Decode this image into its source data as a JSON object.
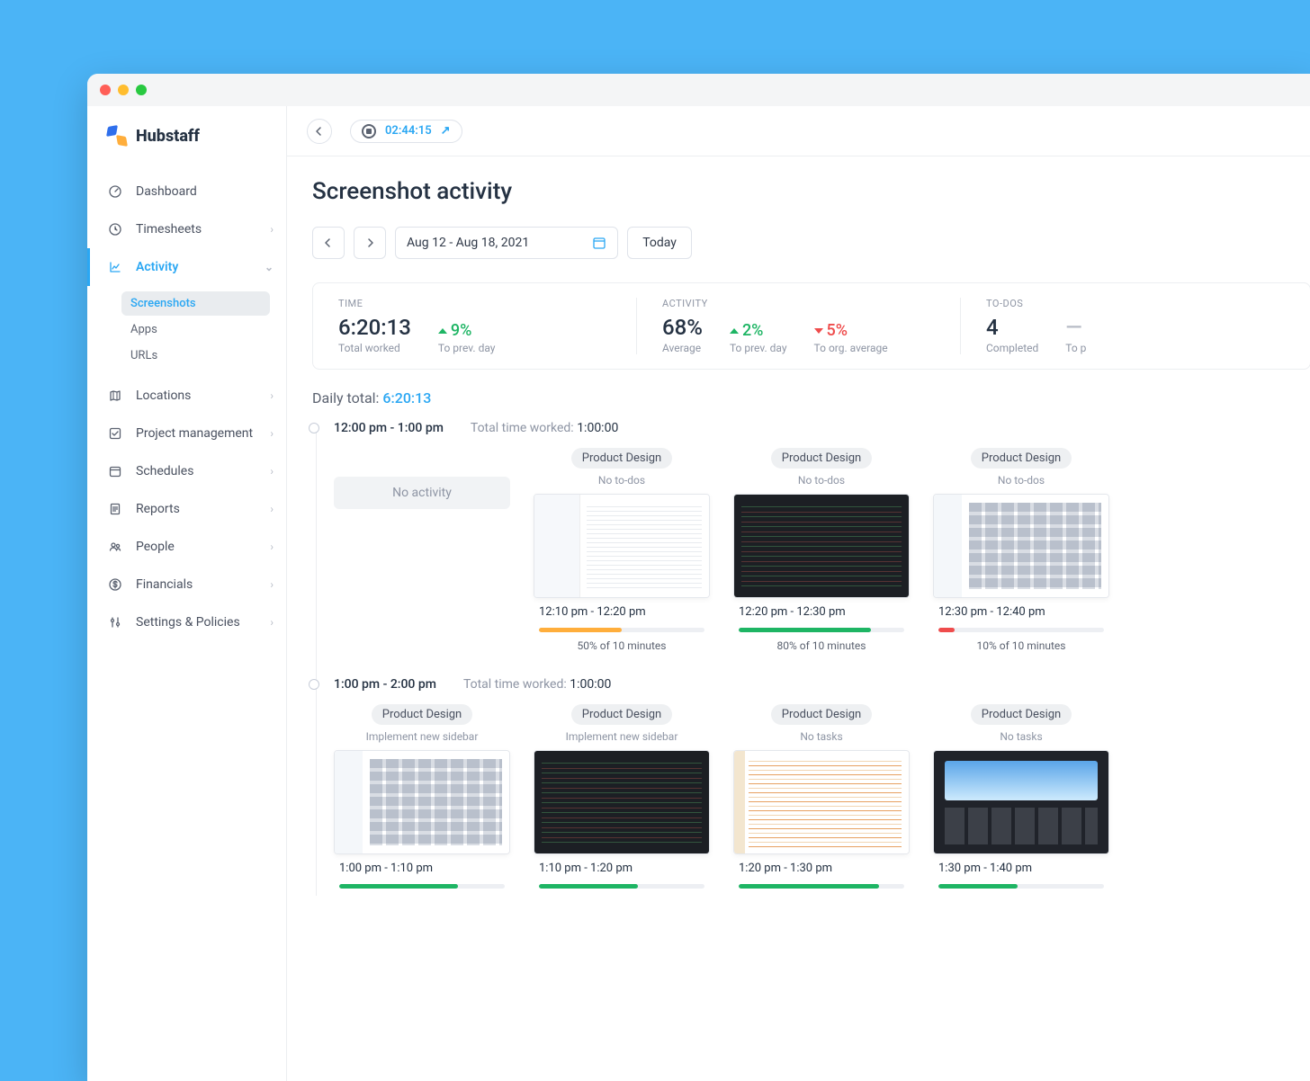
{
  "brand": {
    "name": "Hubstaff"
  },
  "topbar": {
    "timer": "02:44:15"
  },
  "sidebar": {
    "items": [
      {
        "id": "dashboard",
        "label": "Dashboard",
        "icon": "gauge-icon",
        "expandable": false
      },
      {
        "id": "timesheets",
        "label": "Timesheets",
        "icon": "clock-icon",
        "expandable": true
      },
      {
        "id": "activity",
        "label": "Activity",
        "icon": "chart-icon",
        "expandable": true,
        "active": true,
        "children": [
          {
            "id": "screenshots",
            "label": "Screenshots",
            "selected": true
          },
          {
            "id": "apps",
            "label": "Apps"
          },
          {
            "id": "urls",
            "label": "URLs"
          }
        ]
      },
      {
        "id": "locations",
        "label": "Locations",
        "icon": "map-icon",
        "expandable": true
      },
      {
        "id": "project",
        "label": "Project management",
        "icon": "check-icon",
        "expandable": true
      },
      {
        "id": "schedules",
        "label": "Schedules",
        "icon": "calendar-icon",
        "expandable": true
      },
      {
        "id": "reports",
        "label": "Reports",
        "icon": "doc-icon",
        "expandable": true
      },
      {
        "id": "people",
        "label": "People",
        "icon": "people-icon",
        "expandable": true
      },
      {
        "id": "financials",
        "label": "Financials",
        "icon": "dollar-icon",
        "expandable": true
      },
      {
        "id": "settings",
        "label": "Settings & Policies",
        "icon": "sliders-icon",
        "expandable": true
      }
    ]
  },
  "page": {
    "title": "Screenshot activity",
    "date_range": "Aug 12 - Aug 18, 2021",
    "today_label": "Today",
    "summary": {
      "time": {
        "label": "TIME",
        "value": "6:20:13",
        "sub": "Total worked",
        "delta": {
          "value": "9%",
          "dir": "up",
          "sub": "To prev. day"
        }
      },
      "activity": {
        "label": "ACTIVITY",
        "value": "68%",
        "sub": "Average",
        "deltas": [
          {
            "value": "2%",
            "dir": "up",
            "sub": "To prev. day"
          },
          {
            "value": "5%",
            "dir": "down",
            "sub": "To org. average"
          }
        ]
      },
      "todos": {
        "label": "TO-DOS",
        "value": "4",
        "sub": "Completed",
        "extra": "To p"
      }
    },
    "daily_total": {
      "label": "Daily total:",
      "value": "6:20:13"
    },
    "slots": [
      {
        "range": "12:00  pm - 1:00 pm",
        "total_label": "Total time worked:",
        "total_value": "1:00:00",
        "cards": [
          {
            "no_activity_label": "No activity"
          },
          {
            "project": "Product Design",
            "subtitle": "No to-dos",
            "thumb": "light",
            "span": "12:10 pm - 12:20 pm",
            "pct": 50,
            "pct_label": "50% of 10 minutes",
            "color": "#ffae3c"
          },
          {
            "project": "Product Design",
            "subtitle": "No to-dos",
            "thumb": "dark",
            "span": "12:20 pm - 12:30 pm",
            "pct": 80,
            "pct_label": "80% of 10 minutes",
            "color": "#1eb564"
          },
          {
            "project": "Product Design",
            "subtitle": "No to-dos",
            "thumb": "thumbs",
            "span": "12:30 pm - 12:40 pm",
            "pct": 10,
            "pct_label": "10% of 10 minutes",
            "color": "#ef4c4c"
          }
        ]
      },
      {
        "range": "1:00  pm - 2:00 pm",
        "total_label": "Total time worked:",
        "total_value": "1:00:00",
        "cards": [
          {
            "project": "Product Design",
            "subtitle": "Implement new sidebar",
            "thumb": "thumbs",
            "span": "1:00 pm - 1:10 pm",
            "pct": 72,
            "pct_label": "",
            "color": "#1eb564"
          },
          {
            "project": "Product Design",
            "subtitle": "Implement new sidebar",
            "thumb": "dark",
            "span": "1:10 pm - 1:20 pm",
            "pct": 60,
            "pct_label": "",
            "color": "#1eb564"
          },
          {
            "project": "Product Design",
            "subtitle": "No tasks",
            "thumb": "code",
            "span": "1:20 pm - 1:30 pm",
            "pct": 85,
            "pct_label": "",
            "color": "#1eb564"
          },
          {
            "project": "Product Design",
            "subtitle": "No tasks",
            "thumb": "browser",
            "span": "1:30 pm - 1:40 pm",
            "pct": 48,
            "pct_label": "",
            "color": "#1eb564"
          }
        ]
      }
    ]
  }
}
